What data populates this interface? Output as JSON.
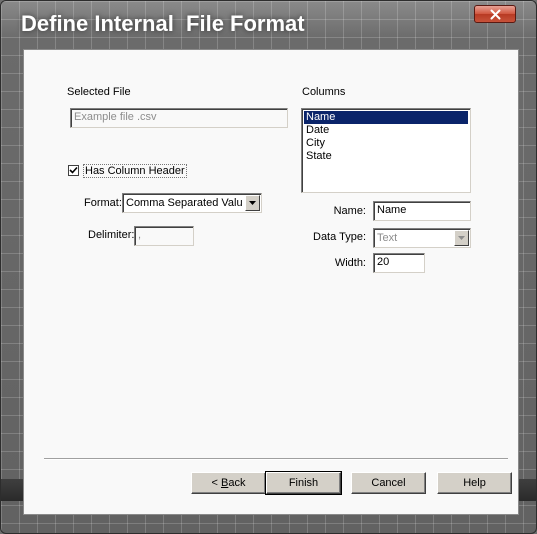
{
  "window": {
    "title": "Define Internal  File Format"
  },
  "left_panel": {
    "selected_file_label": "Selected File",
    "selected_file_value": "Example file .csv",
    "has_header_label": "Has Column Header",
    "has_header_checked": true,
    "format_label": "Format:",
    "format_value": "Comma Separated Value",
    "delimiter_label": "Delimiter:",
    "delimiter_value": ","
  },
  "right_panel": {
    "columns_label": "Columns",
    "columns": [
      "Name",
      "Date",
      "City",
      "State"
    ],
    "selected_column": "Name",
    "name_label": "Name:",
    "name_value": "Name",
    "data_type_label": "Data Type:",
    "data_type_value": "Text",
    "width_label": "Width:",
    "width_value": "20"
  },
  "buttons": {
    "back_label_accel": "B",
    "back_label_rest": "ack",
    "back_prefix": "< ",
    "finish_label": "Finish",
    "cancel_label": "Cancel",
    "help_label": "Help"
  },
  "colors": {
    "selection": "#0a246a",
    "close_button": "#c7533b"
  }
}
